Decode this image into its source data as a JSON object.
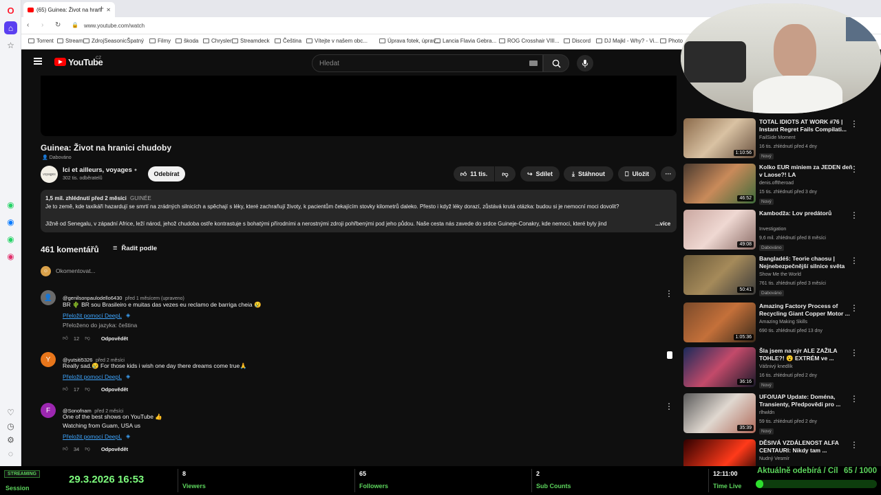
{
  "browser": {
    "tab_title": "(65) Guinea: Život na hrani",
    "url": "www.youtube.com/watch",
    "bookmarks": [
      "Torrent",
      "Stream",
      "ZdrojSeasonicŠpatný",
      "Filmy",
      "škoda",
      "Chrysler",
      "Streamdeck",
      "Čeština",
      "Vítejte v našem obc...",
      "Úprava fotek, úprav...",
      "Lancia Flavia Gebra...",
      "ROG Crosshair VIII...",
      "Discord",
      "DJ Majkl - Why? - Vi...",
      "Photo"
    ]
  },
  "youtube": {
    "logo": "YouTube",
    "country": "CZ",
    "search_placeholder": "Hledat"
  },
  "video": {
    "title": "Guinea: Život na hranici chudoby",
    "dub_badge": "Dabováno",
    "channel": "Ici et ailleurs, voyages",
    "subscribers": "302 tis. odběratelů",
    "subscribe": "Odebírat",
    "likes": "11 tis.",
    "share": "Sdílet",
    "download": "Stáhnout",
    "save": "Uložit",
    "views_date": "1,5 mil. zhlédnutí  před 2 měsíci",
    "tag": "GUINÉE",
    "desc1": "Je to země, kde taxikáři hazardují se smrtí na zrádných silnicích a spěchají s léky, které zachraňují životy, k pacientům čekajícím stovky kilometrů daleko. Přesto i když léky dorazí, zůstává krutá otázka: budou si je nemocní moci dovolit?",
    "desc2": "Jižně od Senegalu, v západní Africe, leží národ, jehož chudoba ostře kontrastuje s bohatými přírodními a nerostnými zdroji pohřbenými pod jeho půdou. Naše cesta nás zavede do srdce Guineje-Conakry, kde nemoci, které byly jind",
    "more": "...více"
  },
  "comments": {
    "count": "461 komentářů",
    "sort": "Řadit podle",
    "add_placeholder": "Okomentovat...",
    "items": [
      {
        "author": "@genilsonpaulodello6430",
        "time": "před 1 měsícem (upraveno)",
        "text": "BR 🌵 BR sou Brasileiro e muitas das vezes eu reclamo de barriga cheia 😢",
        "translate": "Přeložit pomocí DeepL",
        "translated": "Přeloženo do jazyka: čeština",
        "likes": "12",
        "reply": "Odpovědět"
      },
      {
        "author": "@yutsiti5326",
        "time": "před 2 měsíci",
        "text": "Really sad.😢 For those kids i wish one day there dreams come true🙏",
        "translate": "Přeložit pomocí DeepL",
        "likes": "17",
        "reply": "Odpovědět",
        "avatar": "Y"
      },
      {
        "author": "@Sonofnam",
        "time": "před 2 měsíci",
        "text": "One of the best shows on YouTube 👍",
        "text2": "Watching from Guam,  USA us",
        "translate": "Přeložit pomocí DeepL",
        "likes": "34",
        "reply": "Odpovědět",
        "avatar": "F"
      }
    ]
  },
  "recommended": [
    {
      "title": "TOTAL IDIOTS AT WORK #76 | Instant Regret Fails Compilati...",
      "channel": "FailSide Moment",
      "meta": "16 tis. zhlédnutí  před 4 dny",
      "badge": "Nový",
      "duration": "1:10:56"
    },
    {
      "title": "Kolko EUR miniem za JEDEN deň v Laose?! LA",
      "channel": "denis.offtheroad",
      "meta": "15 tis. zhlédnutí  před 3 dny",
      "badge": "Nový",
      "duration": "46:52"
    },
    {
      "title": "Kambodža: Lov predátorů",
      "channel": "Investigation",
      "meta": "9,6 mil. zhlédnutí  před 8 měsíci",
      "badge": "Dabováno",
      "duration": "49:08"
    },
    {
      "title": "Bangladéš: Teorie chaosu | Nejnebezpečnější silnice světa",
      "channel": "Show Me the World",
      "meta": "761 tis. zhlédnutí  před 3 měsíci",
      "badge": "Dabováno",
      "duration": "50:41"
    },
    {
      "title": "Amazing Factory Process of Recycling Giant Copper Motor ...",
      "channel": "Amazing Making Skills",
      "meta": "690 tis. zhlédnutí  před 13 dny",
      "badge": "",
      "duration": "1:05:36"
    },
    {
      "title": "Šla jsem na sýr ALE ZAŽILA TOHLE?! 😮 EXTRÉM ve ...",
      "channel": "Vášnivý knedlík",
      "meta": "16 tis. zhlédnutí  před 2 dny",
      "badge": "Nový",
      "duration": "36:16"
    },
    {
      "title": "UFO/UAP Update: Doména, Transienty, Předpovědi pro ...",
      "channel": "rlhwldn",
      "meta": "59 tis. zhlédnutí  před 2 dny",
      "badge": "Nový",
      "duration": "35:39"
    },
    {
      "title": "DĚSIVÁ VZDÁLENOST ALFA CENTAURI: Nikdy tam ...",
      "channel": "Nudný Vesmír",
      "meta": "",
      "badge": "",
      "duration": ""
    }
  ],
  "overlay": {
    "streaming": "STREAMING",
    "session": "Session",
    "datetime": "29.3.2026 16:53",
    "viewers_val": "8",
    "viewers": "Viewers",
    "followers_val": "65",
    "followers": "Followers",
    "subcounts_val": "2",
    "subcounts": "Sub Counts",
    "time_val": "12:11:00",
    "time_live": "Time Live",
    "goal_label": "Aktuálně odebírá / Cíl",
    "goal_val": "65 / 1000",
    "goal_progress": 0.065
  }
}
